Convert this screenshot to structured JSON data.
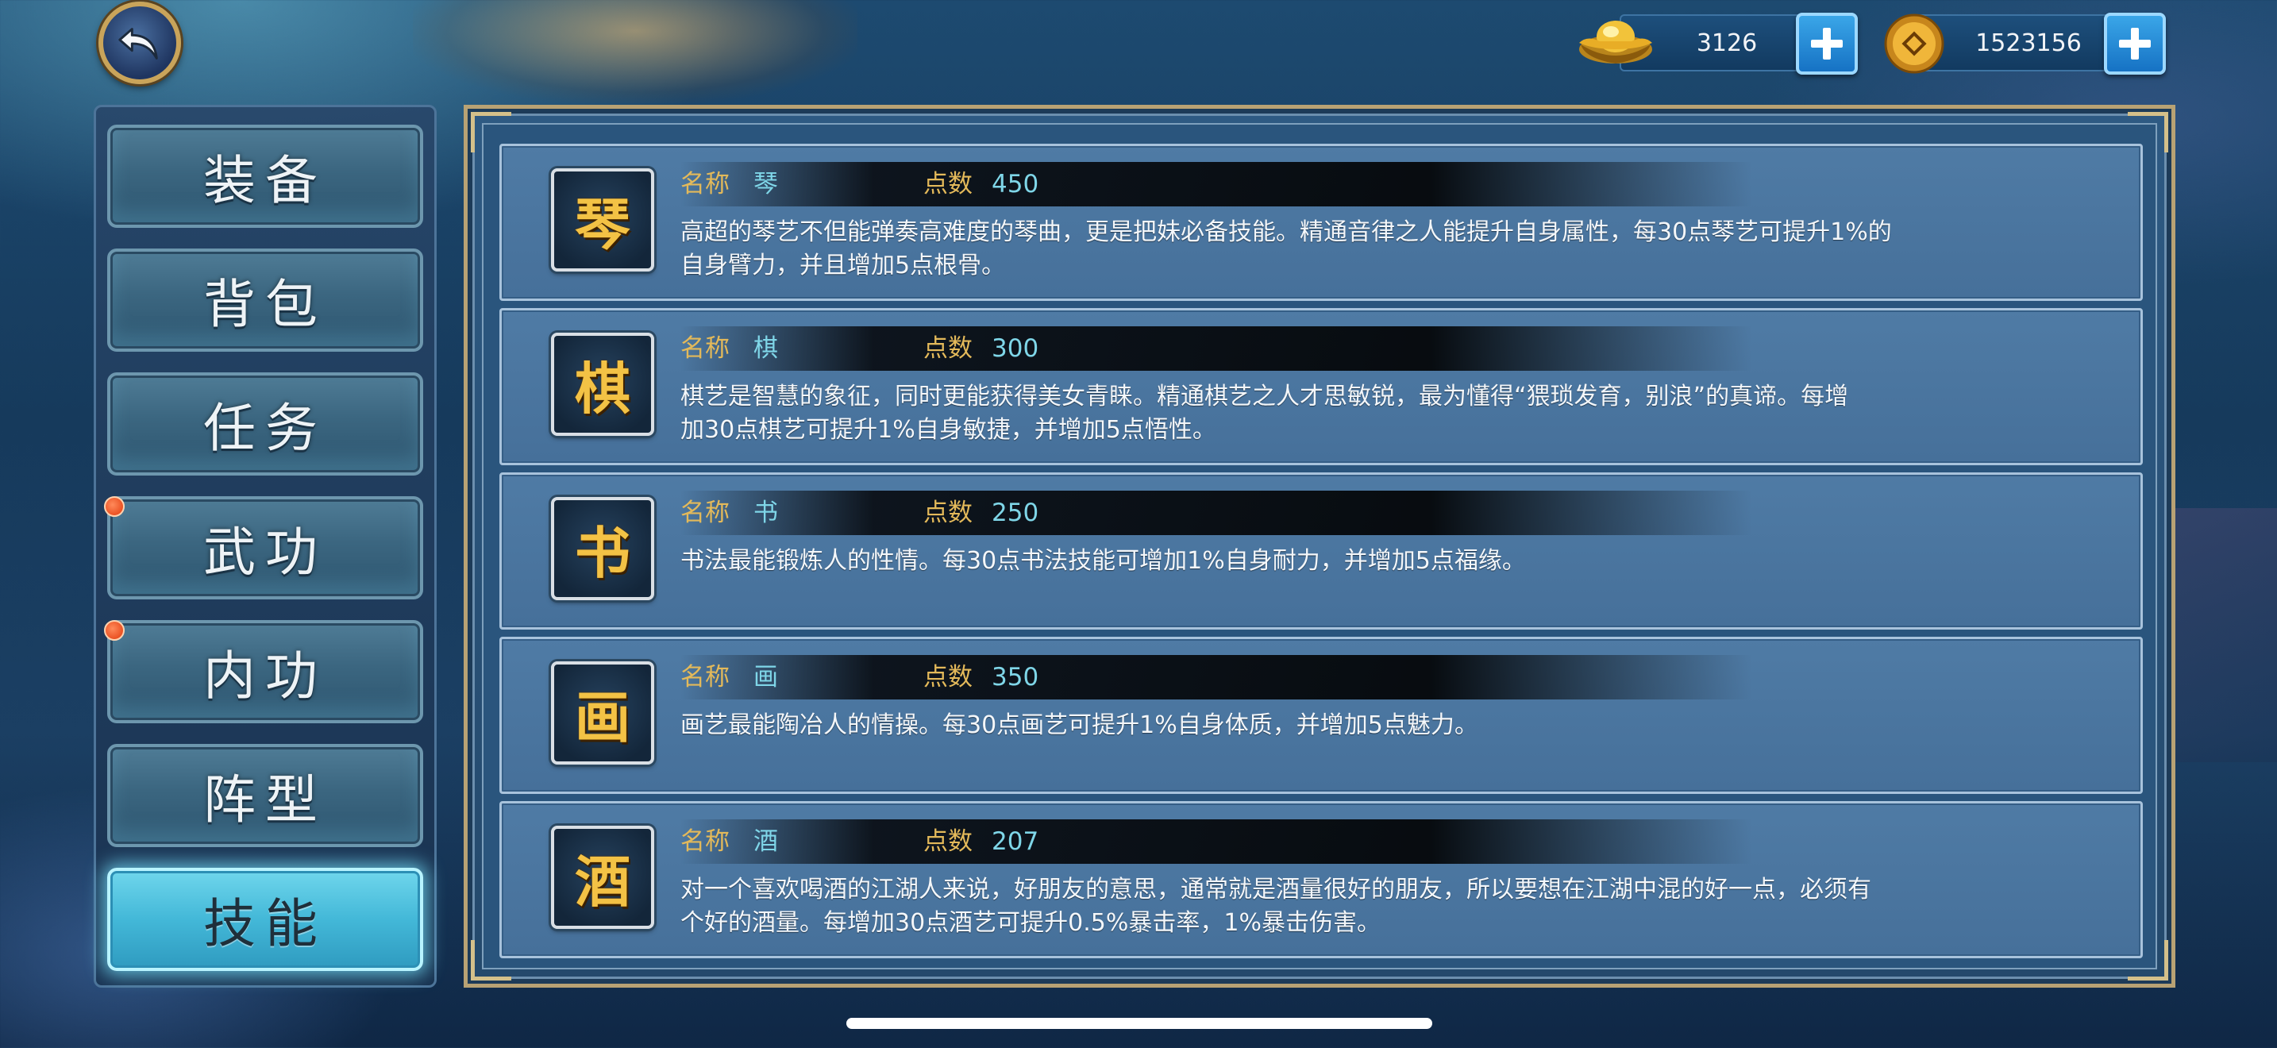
{
  "currency": {
    "gold_icon": "gold-ingot-icon",
    "gold": "3126",
    "coin_icon": "copper-coin-icon",
    "coins": "1523156"
  },
  "sidebar": {
    "tabs": [
      {
        "label": "装备",
        "notify": false
      },
      {
        "label": "背包",
        "notify": false
      },
      {
        "label": "任务",
        "notify": false
      },
      {
        "label": "武功",
        "notify": true
      },
      {
        "label": "内功",
        "notify": true
      },
      {
        "label": "阵型",
        "notify": false
      },
      {
        "label": "技能",
        "notify": false,
        "active": true
      }
    ]
  },
  "skills": [
    {
      "icon": "琴",
      "name_label": "名称",
      "name": "琴",
      "points_label": "点数",
      "points": "450",
      "desc_line1": "高超的琴艺不但能弹奏高难度的琴曲，更是把妹必备技能。精通音律之人能提升自身属性，每30点琴艺可提升1%的",
      "desc_line2": "自身臂力，并且增加5点根骨。"
    },
    {
      "icon": "棋",
      "name_label": "名称",
      "name": "棋",
      "points_label": "点数",
      "points": "300",
      "desc_line1": "棋艺是智慧的象征，同时更能获得美女青睐。精通棋艺之人才思敏锐，最为懂得“猥琐发育，别浪”的真谛。每增",
      "desc_line2": "加30点棋艺可提升1%自身敏捷，并增加5点悟性。"
    },
    {
      "icon": "书",
      "name_label": "名称",
      "name": "书",
      "points_label": "点数",
      "points": "250",
      "desc_line1": "书法最能锻炼人的性情。每30点书法技能可增加1%自身耐力，并增加5点福缘。",
      "desc_line2": ""
    },
    {
      "icon": "画",
      "name_label": "名称",
      "name": "画",
      "points_label": "点数",
      "points": "350",
      "desc_line1": "画艺最能陶冶人的情操。每30点画艺可提升1%自身体质，并增加5点魅力。",
      "desc_line2": ""
    },
    {
      "icon": "酒",
      "name_label": "名称",
      "name": "酒",
      "points_label": "点数",
      "points": "207",
      "desc_line1": "对一个喜欢喝酒的江湖人来说，好朋友的意思，通常就是酒量很好的朋友，所以要想在江湖中混的好一点，必须有",
      "desc_line2": "个好的酒量。每增加30点酒艺可提升0.5%暴击率，1%暴击伤害。"
    }
  ]
}
